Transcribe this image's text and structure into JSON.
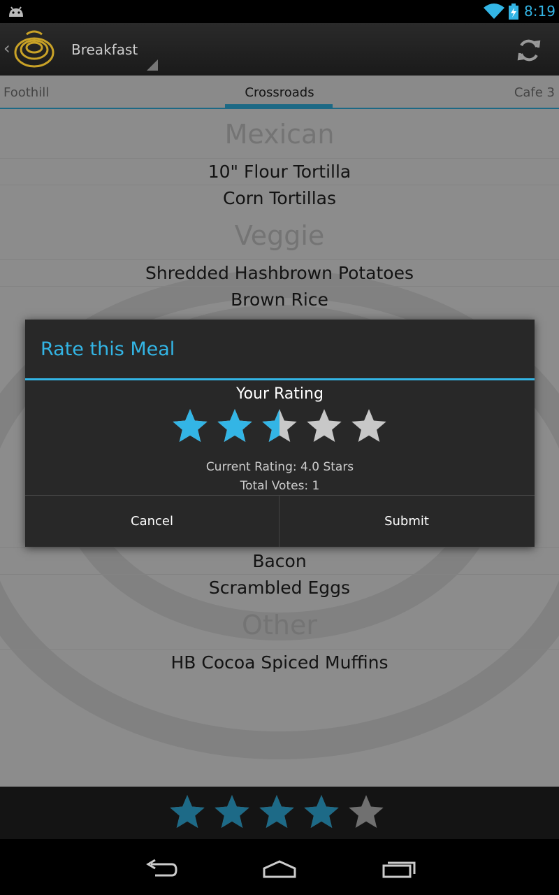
{
  "status_bar": {
    "time": "8:19"
  },
  "action_bar": {
    "title": "Breakfast"
  },
  "tabs": {
    "left": "Foothill",
    "center": "Crossroads",
    "right": "Cafe 3"
  },
  "menu": {
    "categories": [
      "Mexican",
      "Veggie",
      "Other"
    ],
    "items": [
      "10\" Flour Tortilla",
      "Corn Tortillas",
      "Shredded Hashbrown Potatoes",
      "Brown Rice",
      "Bacon",
      "Scrambled Eggs",
      "HB Cocoa Spiced Muffins"
    ]
  },
  "dialog": {
    "title": "Rate this Meal",
    "your_rating_label": "Your Rating",
    "user_rating_stars": 2.5,
    "max_stars": 5,
    "current_rating": "Current Rating: 4.0 Stars",
    "total_votes": "Total Votes: 1",
    "cancel_label": "Cancel",
    "submit_label": "Submit"
  },
  "bottom_rating": {
    "stars": 4,
    "max_stars": 5
  },
  "colors": {
    "accent": "#33b5e5",
    "star_empty": "#a8a8a8"
  }
}
